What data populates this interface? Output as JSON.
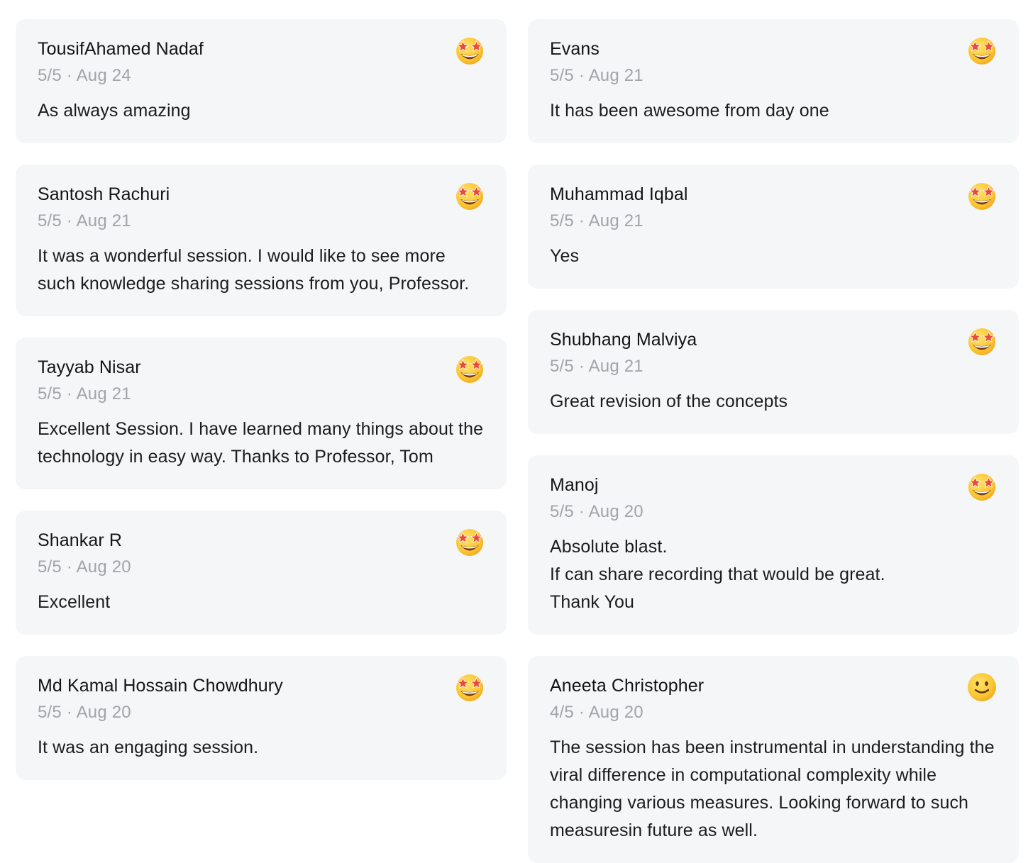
{
  "reviews_left": [
    {
      "name": "TousifAhamed Nadaf",
      "rating": "5/5",
      "date": "Aug 24",
      "text": "As always amazing",
      "emoji": "star-struck-emoji-icon"
    },
    {
      "name": "Santosh Rachuri",
      "rating": "5/5",
      "date": "Aug 21",
      "text": "It was a wonderful session. I would like to see more such knowledge sharing sessions from you, Professor.",
      "emoji": "star-struck-emoji-icon"
    },
    {
      "name": "Tayyab Nisar",
      "rating": "5/5",
      "date": "Aug 21",
      "text": "Excellent Session. I have learned many things about the technology in easy way. Thanks to Professor, Tom",
      "emoji": "star-struck-emoji-icon"
    },
    {
      "name": "Shankar R",
      "rating": "5/5",
      "date": "Aug 20",
      "text": "Excellent",
      "emoji": "star-struck-emoji-icon"
    },
    {
      "name": "Md Kamal Hossain Chowdhury",
      "rating": "5/5",
      "date": "Aug 20",
      "text": "It was an engaging session.",
      "emoji": "star-struck-emoji-icon"
    }
  ],
  "reviews_right": [
    {
      "name": "Evans",
      "rating": "5/5",
      "date": "Aug 21",
      "text": "It has been awesome from day one",
      "emoji": "star-struck-emoji-icon"
    },
    {
      "name": "Muhammad Iqbal",
      "rating": "5/5",
      "date": "Aug 21",
      "text": "Yes",
      "emoji": "star-struck-emoji-icon"
    },
    {
      "name": "Shubhang Malviya",
      "rating": "5/5",
      "date": "Aug 21",
      "text": "Great revision of the concepts",
      "emoji": "star-struck-emoji-icon"
    },
    {
      "name": "Manoj",
      "rating": "5/5",
      "date": "Aug 20",
      "text": "Absolute blast.\nIf can share recording that would be great.\nThank You",
      "emoji": "star-struck-emoji-icon"
    },
    {
      "name": "Aneeta Christopher",
      "rating": "4/5",
      "date": "Aug 20",
      "text": "The session has been instrumental in understanding the viral difference in computational complexity while changing various measures. Looking forward to such measuresin future as well.",
      "emoji": "slightly-smiling-emoji-icon"
    }
  ],
  "meta_separator": " · ",
  "colors": {
    "card_bg": "#f5f6f8",
    "meta_text": "#a3a3a8",
    "emoji_yellow": "#ffcc33"
  }
}
